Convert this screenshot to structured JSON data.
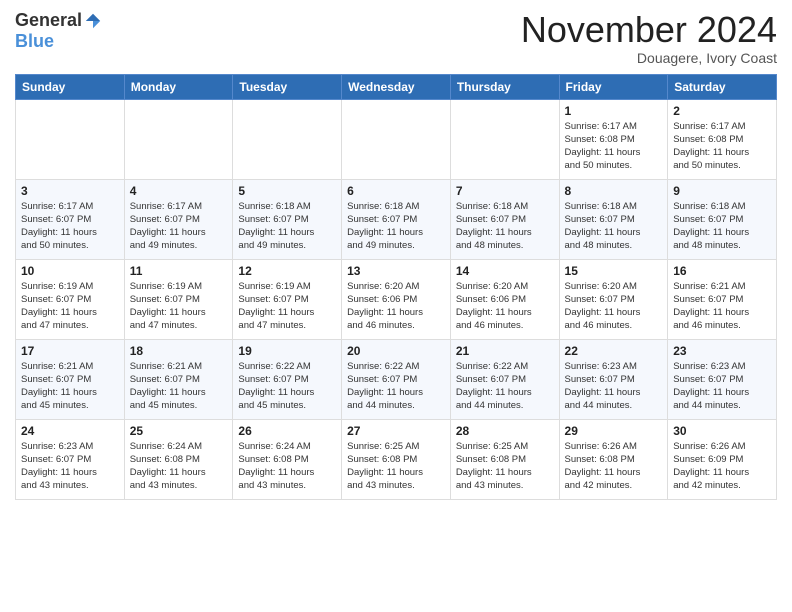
{
  "header": {
    "logo_general": "General",
    "logo_blue": "Blue",
    "month_title": "November 2024",
    "location": "Douagere, Ivory Coast"
  },
  "weekdays": [
    "Sunday",
    "Monday",
    "Tuesday",
    "Wednesday",
    "Thursday",
    "Friday",
    "Saturday"
  ],
  "weeks": [
    [
      {
        "day": "",
        "info": ""
      },
      {
        "day": "",
        "info": ""
      },
      {
        "day": "",
        "info": ""
      },
      {
        "day": "",
        "info": ""
      },
      {
        "day": "",
        "info": ""
      },
      {
        "day": "1",
        "info": "Sunrise: 6:17 AM\nSunset: 6:08 PM\nDaylight: 11 hours\nand 50 minutes."
      },
      {
        "day": "2",
        "info": "Sunrise: 6:17 AM\nSunset: 6:08 PM\nDaylight: 11 hours\nand 50 minutes."
      }
    ],
    [
      {
        "day": "3",
        "info": "Sunrise: 6:17 AM\nSunset: 6:07 PM\nDaylight: 11 hours\nand 50 minutes."
      },
      {
        "day": "4",
        "info": "Sunrise: 6:17 AM\nSunset: 6:07 PM\nDaylight: 11 hours\nand 49 minutes."
      },
      {
        "day": "5",
        "info": "Sunrise: 6:18 AM\nSunset: 6:07 PM\nDaylight: 11 hours\nand 49 minutes."
      },
      {
        "day": "6",
        "info": "Sunrise: 6:18 AM\nSunset: 6:07 PM\nDaylight: 11 hours\nand 49 minutes."
      },
      {
        "day": "7",
        "info": "Sunrise: 6:18 AM\nSunset: 6:07 PM\nDaylight: 11 hours\nand 48 minutes."
      },
      {
        "day": "8",
        "info": "Sunrise: 6:18 AM\nSunset: 6:07 PM\nDaylight: 11 hours\nand 48 minutes."
      },
      {
        "day": "9",
        "info": "Sunrise: 6:18 AM\nSunset: 6:07 PM\nDaylight: 11 hours\nand 48 minutes."
      }
    ],
    [
      {
        "day": "10",
        "info": "Sunrise: 6:19 AM\nSunset: 6:07 PM\nDaylight: 11 hours\nand 47 minutes."
      },
      {
        "day": "11",
        "info": "Sunrise: 6:19 AM\nSunset: 6:07 PM\nDaylight: 11 hours\nand 47 minutes."
      },
      {
        "day": "12",
        "info": "Sunrise: 6:19 AM\nSunset: 6:07 PM\nDaylight: 11 hours\nand 47 minutes."
      },
      {
        "day": "13",
        "info": "Sunrise: 6:20 AM\nSunset: 6:06 PM\nDaylight: 11 hours\nand 46 minutes."
      },
      {
        "day": "14",
        "info": "Sunrise: 6:20 AM\nSunset: 6:06 PM\nDaylight: 11 hours\nand 46 minutes."
      },
      {
        "day": "15",
        "info": "Sunrise: 6:20 AM\nSunset: 6:07 PM\nDaylight: 11 hours\nand 46 minutes."
      },
      {
        "day": "16",
        "info": "Sunrise: 6:21 AM\nSunset: 6:07 PM\nDaylight: 11 hours\nand 46 minutes."
      }
    ],
    [
      {
        "day": "17",
        "info": "Sunrise: 6:21 AM\nSunset: 6:07 PM\nDaylight: 11 hours\nand 45 minutes."
      },
      {
        "day": "18",
        "info": "Sunrise: 6:21 AM\nSunset: 6:07 PM\nDaylight: 11 hours\nand 45 minutes."
      },
      {
        "day": "19",
        "info": "Sunrise: 6:22 AM\nSunset: 6:07 PM\nDaylight: 11 hours\nand 45 minutes."
      },
      {
        "day": "20",
        "info": "Sunrise: 6:22 AM\nSunset: 6:07 PM\nDaylight: 11 hours\nand 44 minutes."
      },
      {
        "day": "21",
        "info": "Sunrise: 6:22 AM\nSunset: 6:07 PM\nDaylight: 11 hours\nand 44 minutes."
      },
      {
        "day": "22",
        "info": "Sunrise: 6:23 AM\nSunset: 6:07 PM\nDaylight: 11 hours\nand 44 minutes."
      },
      {
        "day": "23",
        "info": "Sunrise: 6:23 AM\nSunset: 6:07 PM\nDaylight: 11 hours\nand 44 minutes."
      }
    ],
    [
      {
        "day": "24",
        "info": "Sunrise: 6:23 AM\nSunset: 6:07 PM\nDaylight: 11 hours\nand 43 minutes."
      },
      {
        "day": "25",
        "info": "Sunrise: 6:24 AM\nSunset: 6:08 PM\nDaylight: 11 hours\nand 43 minutes."
      },
      {
        "day": "26",
        "info": "Sunrise: 6:24 AM\nSunset: 6:08 PM\nDaylight: 11 hours\nand 43 minutes."
      },
      {
        "day": "27",
        "info": "Sunrise: 6:25 AM\nSunset: 6:08 PM\nDaylight: 11 hours\nand 43 minutes."
      },
      {
        "day": "28",
        "info": "Sunrise: 6:25 AM\nSunset: 6:08 PM\nDaylight: 11 hours\nand 43 minutes."
      },
      {
        "day": "29",
        "info": "Sunrise: 6:26 AM\nSunset: 6:08 PM\nDaylight: 11 hours\nand 42 minutes."
      },
      {
        "day": "30",
        "info": "Sunrise: 6:26 AM\nSunset: 6:09 PM\nDaylight: 11 hours\nand 42 minutes."
      }
    ]
  ]
}
